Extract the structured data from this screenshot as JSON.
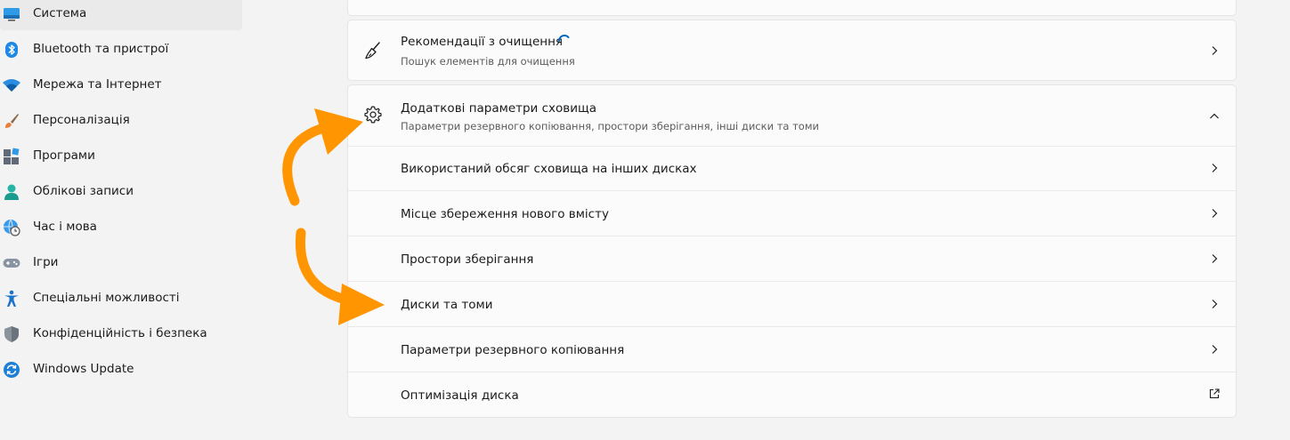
{
  "sidebar": {
    "items": [
      {
        "label": "Система",
        "icon": "monitor-icon",
        "active": true
      },
      {
        "label": "Bluetooth та пристрої",
        "icon": "bluetooth-icon"
      },
      {
        "label": "Мережа та Інтернет",
        "icon": "wifi-icon"
      },
      {
        "label": "Персоналізація",
        "icon": "brush-icon"
      },
      {
        "label": "Програми",
        "icon": "apps-icon"
      },
      {
        "label": "Облікові записи",
        "icon": "person-icon"
      },
      {
        "label": "Час і мова",
        "icon": "globe-clock-icon"
      },
      {
        "label": "Ігри",
        "icon": "gamepad-icon"
      },
      {
        "label": "Спеціальні можливості",
        "icon": "accessibility-icon"
      },
      {
        "label": "Конфіденційність і безпека",
        "icon": "shield-icon"
      },
      {
        "label": "Windows Update",
        "icon": "update-icon"
      }
    ]
  },
  "cleanup": {
    "title": "Рекомендації з очищення",
    "subtitle": "Пошук елементів для очищення",
    "icon": "broom-icon"
  },
  "advanced": {
    "title": "Додаткові параметри сховища",
    "subtitle": "Параметри резервного копіювання, простори зберігання, інші диски та томи",
    "icon": "gear-icon",
    "expanded": true,
    "items": [
      {
        "label": "Використаний обсяг сховища на інших дисках",
        "icon": "chevron-right-icon"
      },
      {
        "label": "Місце збереження нового вмісту",
        "icon": "chevron-right-icon"
      },
      {
        "label": "Простори зберігання",
        "icon": "chevron-right-icon"
      },
      {
        "label": "Диски та томи",
        "icon": "chevron-right-icon"
      },
      {
        "label": "Параметри резервного копіювання",
        "icon": "chevron-right-icon"
      },
      {
        "label": "Оптимізація диска",
        "icon": "open-external-icon"
      }
    ]
  },
  "colors": {
    "accent": "#0067c0",
    "annotation_arrow": "#ff9500",
    "page_bg": "#f3f3f3",
    "card_bg": "#fbfbfb"
  }
}
